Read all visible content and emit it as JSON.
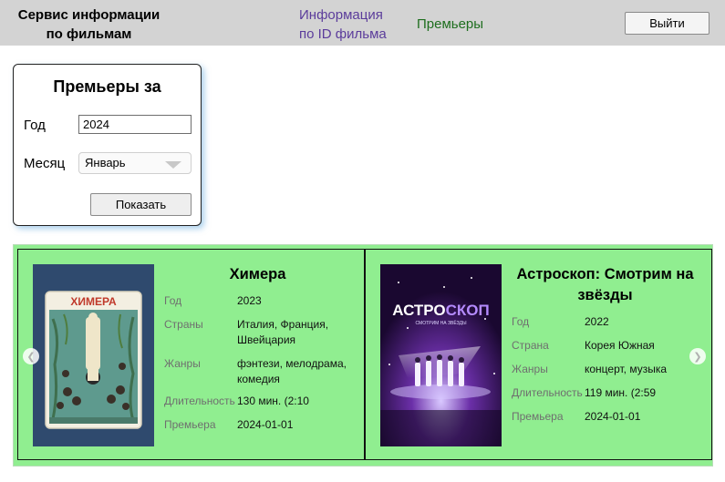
{
  "header": {
    "app_title": "Сервис информации по фильмам",
    "app_title_line1": "Сервис информации",
    "app_title_line2": "по фильмам",
    "nav_info_line1": "Информация",
    "nav_info_line2": "по ID фильма",
    "nav_premieres": "Премьеры",
    "logout": "Выйти",
    "colors": {
      "background": "#d3d3d3",
      "nav_info": "#5b3c9b",
      "nav_premieres": "#1e6e1e"
    }
  },
  "form": {
    "title": "Премьеры за",
    "year_label": "Год",
    "year_value": "2024",
    "month_label": "Месяц",
    "month_value": "Январь",
    "submit": "Показать"
  },
  "carousel": {
    "background": "#90ee90",
    "prev_icon": "chevron-left-icon",
    "next_icon": "chevron-right-icon",
    "films": [
      {
        "title": "Химера",
        "poster_text": "ХИМЕРА",
        "rows": [
          {
            "key": "Год",
            "value": "2023"
          },
          {
            "key": "Страны",
            "value": "Италия, Франция, Швейцария"
          },
          {
            "key": "Жанры",
            "value": "фэнтези, мелодрама, комедия"
          },
          {
            "key": "Длительность",
            "value": "130 мин. (2:10"
          },
          {
            "key": "Премьера",
            "value": "2024-01-01"
          }
        ]
      },
      {
        "title": "Астроскоп: Смотрим на звёзды",
        "poster_text_a": "АСТРО",
        "poster_text_b": "СКОП",
        "poster_subtext": "СМОТРИМ НА ЗВЁЗДЫ",
        "rows": [
          {
            "key": "Год",
            "value": "2022"
          },
          {
            "key": "Страна",
            "value": "Корея Южная"
          },
          {
            "key": "Жанры",
            "value": "концерт, музыка"
          },
          {
            "key": "Длительность",
            "value": "119 мин. (2:59"
          },
          {
            "key": "Премьера",
            "value": "2024-01-01"
          }
        ]
      }
    ]
  }
}
